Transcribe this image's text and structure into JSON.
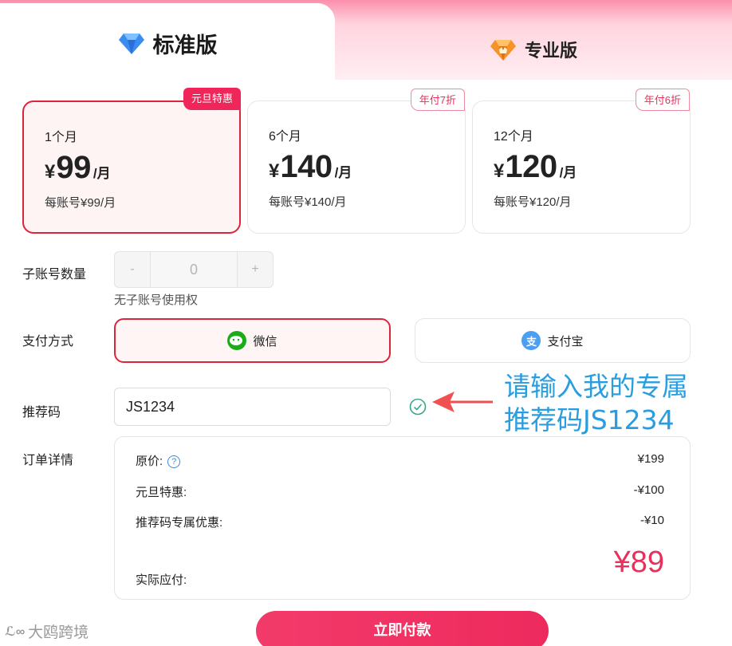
{
  "tabs": {
    "standard": "标准版",
    "pro": "专业版"
  },
  "plans": [
    {
      "duration": "1个月",
      "yen": "¥",
      "amount": "99",
      "unit": "/月",
      "per_account": "每账号¥99/月",
      "badge": "元旦特惠",
      "selected": true
    },
    {
      "duration": "6个月",
      "yen": "¥",
      "amount": "140",
      "unit": "/月",
      "per_account": "每账号¥140/月",
      "badge": "年付7折",
      "selected": false
    },
    {
      "duration": "12个月",
      "yen": "¥",
      "amount": "120",
      "unit": "/月",
      "per_account": "每账号¥120/月",
      "badge": "年付6折",
      "selected": false
    }
  ],
  "sub_accounts": {
    "label": "子账号数量",
    "minus": "-",
    "value": "0",
    "plus": "+",
    "hint": "无子账号使用权"
  },
  "payment": {
    "label": "支付方式",
    "wechat": "微信",
    "alipay": "支付宝",
    "selected": "微信"
  },
  "referral": {
    "label": "推荐码",
    "value": "JS1234",
    "annotation_line1": "请输入我的专属",
    "annotation_line2": "推荐码JS1234"
  },
  "order": {
    "label": "订单详情",
    "original_label": "原价:",
    "original_value": "¥199",
    "newyear_label": "元旦特惠:",
    "newyear_value": "-¥100",
    "referral_label": "推荐码专属优惠:",
    "referral_value": "-¥10",
    "actual_label": "实际应付:",
    "actual_value": "¥89"
  },
  "pay_now": "立即付款",
  "watermark": "大鸥跨境",
  "colors": {
    "accent": "#d9263b",
    "pink": "#f0265a",
    "annotation": "#2a9de0"
  }
}
